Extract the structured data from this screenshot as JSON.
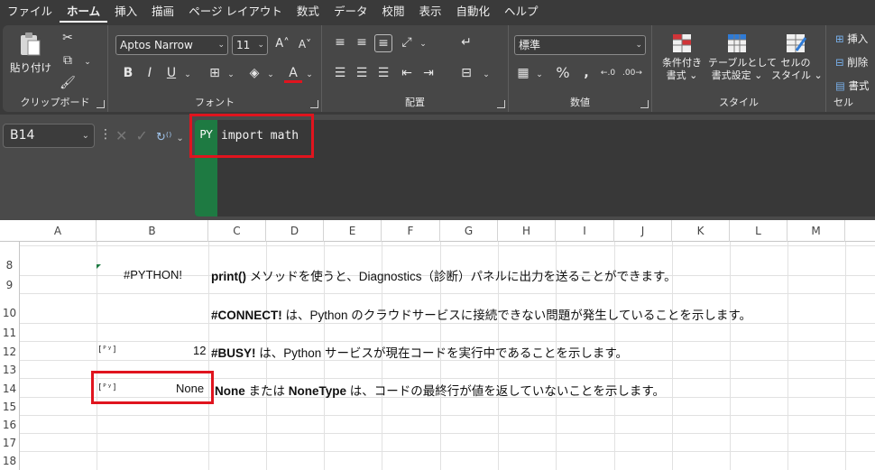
{
  "menu": [
    "ファイル",
    "ホーム",
    "挿入",
    "描画",
    "ページ レイアウト",
    "数式",
    "データ",
    "校閲",
    "表示",
    "自動化",
    "ヘルプ"
  ],
  "menu_active": "ホーム",
  "ribbon": {
    "clipboard": {
      "label": "クリップボード",
      "paste": "貼り付け"
    },
    "font": {
      "label": "フォント",
      "name": "Aptos Narrow",
      "size": "11",
      "bold": "B",
      "italic": "I",
      "underline": "U"
    },
    "alignment": {
      "label": "配置"
    },
    "number": {
      "label": "数値",
      "format": "標準",
      "percent": "%"
    },
    "styles": {
      "label": "スタイル",
      "conditional": [
        "条件付き",
        "書式 ⌄"
      ],
      "table": [
        "テーブルとして",
        "書式設定 ⌄"
      ],
      "cell": [
        "セルの",
        "スタイル ⌄"
      ]
    },
    "cells": {
      "label": "セル",
      "insert": "挿入",
      "delete": "削除",
      "format": "書式"
    }
  },
  "formula_bar": {
    "name_box": "B14",
    "badge": "PY",
    "formula": "import math"
  },
  "columns": [
    "A",
    "B",
    "C",
    "D",
    "E",
    "F",
    "G",
    "H",
    "I",
    "J",
    "K",
    "L",
    "M"
  ],
  "rows": [
    "8",
    "9",
    "10",
    "11",
    "12",
    "13",
    "14",
    "15",
    "16",
    "17",
    "18"
  ],
  "cells": {
    "b8": "#PYTHON!",
    "c8_bold": "print()",
    "c8_rest": " メソッドを使うと、Diagnostics（診断）パネルに出力を送ることができます。",
    "c10_bold": "#CONNECT!",
    "c10_rest": " は、Python のクラウドサービスに接続できない問題が発生していることを示します。",
    "b12": "12",
    "b12_icon": "[ᴾʸ]",
    "c12_bold": "#BUSY!",
    "c12_rest": " は、Python サービスが現在コードを実行中であることを示します。",
    "b14": "None",
    "b14_icon": "[ᴾʸ]",
    "c14_bold1": "None",
    "c14_mid": " または ",
    "c14_bold2": "NoneType",
    "c14_rest": " は、コードの最終行が値を返していないことを示します。"
  },
  "icons": [
    "paste-icon",
    "cut-icon",
    "copy-icon",
    "format-painter-icon",
    "grow-font-icon",
    "shrink-font-icon",
    "borders-icon",
    "fill-color-icon",
    "font-color-icon",
    "align-icon",
    "wrap-text-icon",
    "merge-icon",
    "currency-icon",
    "comma-icon",
    "increase-decimal-icon",
    "decrease-decimal-icon",
    "conditional-format-icon",
    "table-format-icon",
    "cell-style-icon"
  ],
  "colors": {
    "highlight": "#e0141e",
    "python_green": "#1e7a42",
    "ribbon_bg": "#474747"
  }
}
